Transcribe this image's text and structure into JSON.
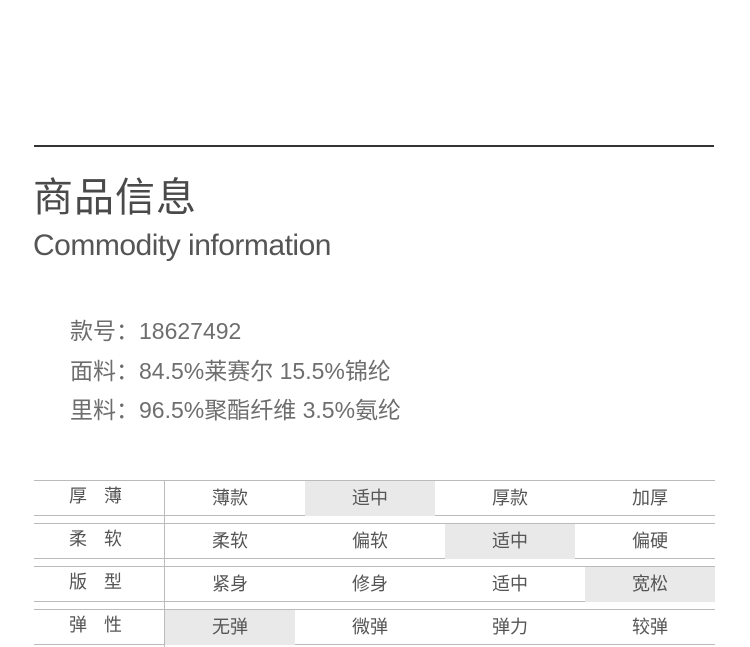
{
  "header": {
    "title_cn": "商品信息",
    "title_en": "Commodity information"
  },
  "specs": [
    {
      "label": "款号：",
      "value": "18627492"
    },
    {
      "label": "面料：",
      "value": "84.5%莱赛尔 15.5%锦纶"
    },
    {
      "label": "里料：",
      "value": "96.5%聚酯纤维 3.5%氨纶"
    }
  ],
  "attributes": [
    {
      "label": "厚薄",
      "options": [
        "薄款",
        "适中",
        "厚款",
        "加厚"
      ],
      "selected": "适中"
    },
    {
      "label": "柔软",
      "options": [
        "柔软",
        "偏软",
        "适中",
        "偏硬"
      ],
      "selected": "适中"
    },
    {
      "label": "版型",
      "options": [
        "紧身",
        "修身",
        "适中",
        "宽松"
      ],
      "selected": "宽松"
    },
    {
      "label": "弹性",
      "options": [
        "无弹",
        "微弹",
        "弹力",
        "较弹"
      ],
      "selected": "无弹"
    }
  ],
  "colors": {
    "highlight": "#e9e9e9",
    "rule": "#333333",
    "grid": "#bbbbbb"
  }
}
